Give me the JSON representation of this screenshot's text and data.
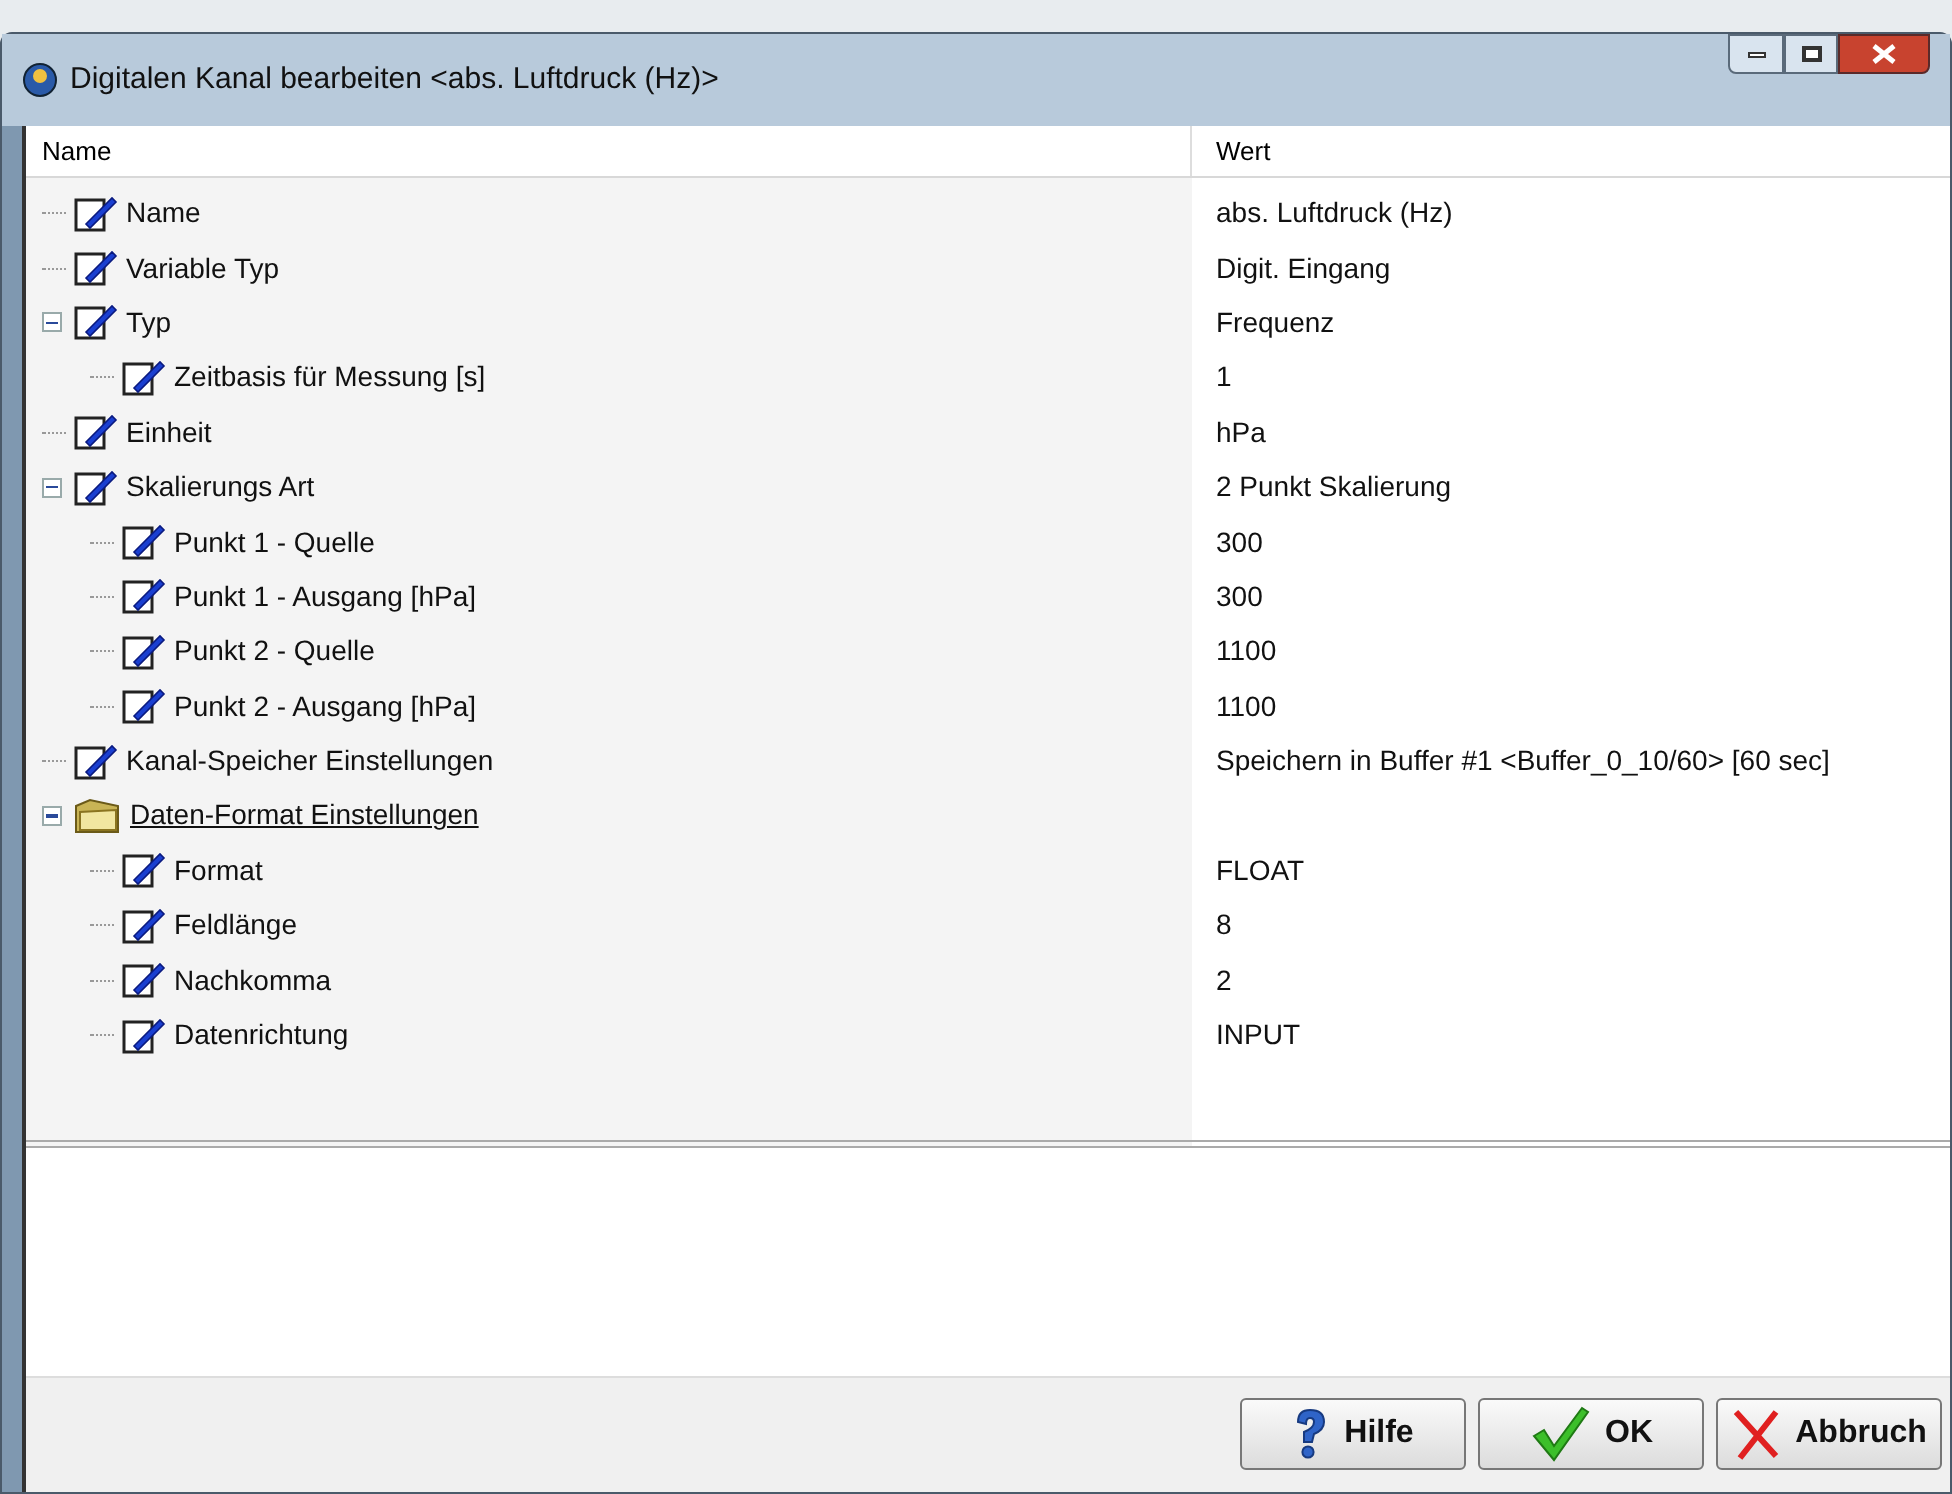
{
  "window": {
    "title": "Digitalen Kanal bearbeiten <abs. Luftdruck (Hz)>"
  },
  "columns": [
    "Name",
    "Wert"
  ],
  "tree": [
    {
      "kind": "property",
      "name": "Name",
      "value": "abs. Luftdruck (Hz)"
    },
    {
      "kind": "property",
      "name": "Variable Typ",
      "value": "Digit. Eingang"
    },
    {
      "kind": "property",
      "name": "Typ",
      "value": "Frequenz",
      "expanded": true,
      "children": [
        {
          "kind": "property",
          "name": "Zeitbasis für Messung [s]",
          "value": "1"
        }
      ]
    },
    {
      "kind": "property",
      "name": "Einheit",
      "value": "hPa"
    },
    {
      "kind": "property",
      "name": "Skalierungs Art",
      "value": "2 Punkt Skalierung",
      "expanded": true,
      "children": [
        {
          "kind": "property",
          "name": "Punkt 1 - Quelle",
          "value": "300"
        },
        {
          "kind": "property",
          "name": "Punkt 1 - Ausgang [hPa]",
          "value": "300"
        },
        {
          "kind": "property",
          "name": "Punkt 2 - Quelle",
          "value": "1100"
        },
        {
          "kind": "property",
          "name": "Punkt 2 - Ausgang [hPa]",
          "value": "1100"
        }
      ]
    },
    {
      "kind": "property",
      "name": "Kanal-Speicher Einstellungen",
      "value": "Speichern in Buffer #1 <Buffer_0_10/60> [60 sec]"
    },
    {
      "kind": "group",
      "name": "Daten-Format Einstellungen",
      "expanded": true,
      "children": [
        {
          "kind": "property",
          "name": "Format",
          "value": "FLOAT"
        },
        {
          "kind": "property",
          "name": "Feldlänge",
          "value": "8"
        },
        {
          "kind": "property",
          "name": "Nachkomma",
          "value": "2"
        },
        {
          "kind": "property",
          "name": "Datenrichtung",
          "value": "INPUT"
        }
      ]
    }
  ],
  "buttons": [
    {
      "kind": "help",
      "label": "Hilfe"
    },
    {
      "kind": "ok",
      "label": "OK"
    },
    {
      "kind": "cancel",
      "label": "Abbruch"
    }
  ]
}
